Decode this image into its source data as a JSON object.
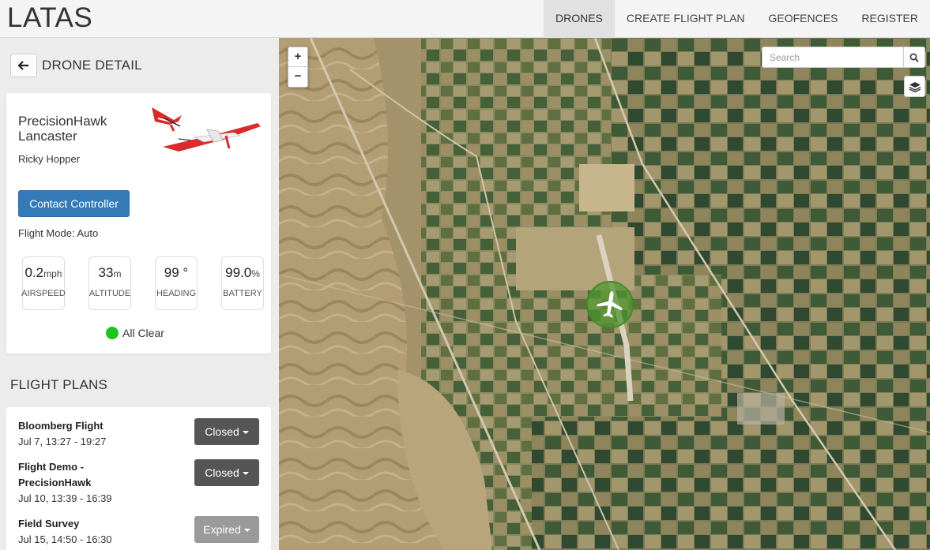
{
  "navbar": {
    "brand": "LATAS",
    "items": [
      {
        "label": "DRONES",
        "active": true
      },
      {
        "label": "CREATE FLIGHT PLAN",
        "active": false
      },
      {
        "label": "GEOFENCES",
        "active": false
      },
      {
        "label": "REGISTER",
        "active": false
      }
    ]
  },
  "detail": {
    "back_icon": "arrow-left-icon",
    "title": "DRONE DETAIL",
    "drone_name": "PrecisionHawk Lancaster",
    "pilot": "Ricky Hopper",
    "contact_label": "Contact Controller",
    "flight_mode": "Flight Mode: Auto",
    "gauges": [
      {
        "value": "0.2",
        "unit": "mph",
        "label": "AIRSPEED"
      },
      {
        "value": "33",
        "unit": "m",
        "label": "ALTITUDE"
      },
      {
        "value": "99 °",
        "unit": "",
        "label": "HEADING"
      },
      {
        "value": "99.0",
        "unit": "%",
        "label": "BATTERY"
      }
    ],
    "status_text": "All Clear",
    "status_color": "#1ec31e"
  },
  "flight_plans": {
    "title": "FLIGHT PLANS",
    "items": [
      {
        "name": "Bloomberg Flight",
        "time": "Jul 7, 13:27 - 19:27",
        "status": "Closed"
      },
      {
        "name": "Flight Demo - PrecisionHawk",
        "time": "Jul 10, 13:39 - 16:39",
        "status": "Closed"
      },
      {
        "name": "Field Survey",
        "time": "Jul 15, 14:50 - 16:30",
        "status": "Expired"
      }
    ]
  },
  "map": {
    "zoom_in": "+",
    "zoom_out": "−",
    "search_placeholder": "Search",
    "search_icon": "search-icon",
    "layers_icon": "layers-icon",
    "marker_icon": "airplane-icon"
  },
  "colors": {
    "primary": "#337ab7",
    "closed": "#555555",
    "expired": "#9a9a9a",
    "marker": "#3e8e26"
  }
}
